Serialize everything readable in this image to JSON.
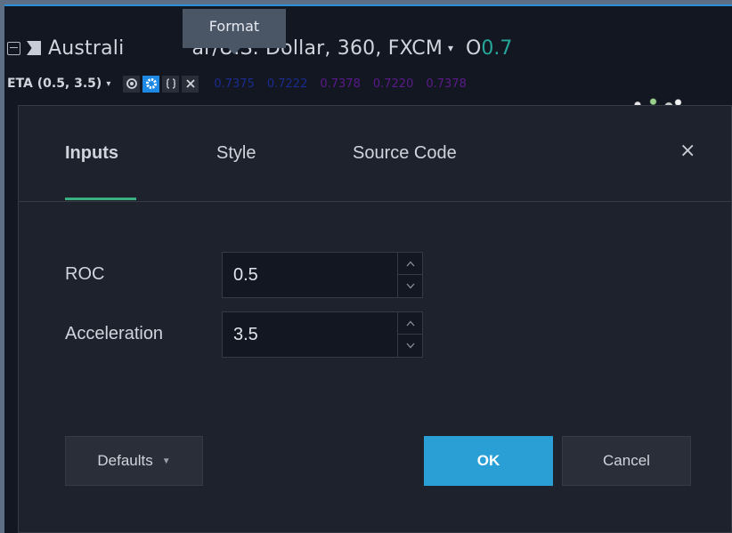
{
  "chart_header": {
    "symbol_title": "Australi",
    "symbol_title_rest": "ar/U.S. Dollar, 360, FXCM",
    "ohlc_label": "O",
    "ohlc_value": "0.7",
    "caret": "▾"
  },
  "tooltip": {
    "text": "Format"
  },
  "indicator": {
    "name": "ETA (0.5, 3.5)",
    "caret": "▾",
    "icons": [
      "eye-icon",
      "gear-icon",
      "source-code-icon",
      "close-icon"
    ],
    "values": [
      {
        "text": "0.7375",
        "color": "#1b2b8f"
      },
      {
        "text": "0.7222",
        "color": "#1b2b8f"
      },
      {
        "text": "0.7378",
        "color": "#5b1a8a"
      },
      {
        "text": "0.7220",
        "color": "#5b1a8a"
      },
      {
        "text": "0.7378",
        "color": "#5b1a8a"
      }
    ]
  },
  "dialog": {
    "tabs": [
      {
        "label": "Inputs",
        "active": true
      },
      {
        "label": "Style",
        "active": false
      },
      {
        "label": "Source Code",
        "active": false
      }
    ],
    "close_glyph": "×",
    "inputs": [
      {
        "label": "ROC",
        "value": "0.5"
      },
      {
        "label": "Acceleration",
        "value": "3.5"
      }
    ],
    "buttons": {
      "defaults": "Defaults",
      "ok": "OK",
      "cancel": "Cancel"
    },
    "accent_color": "#3ab080",
    "ok_color": "#2a9fd6"
  }
}
